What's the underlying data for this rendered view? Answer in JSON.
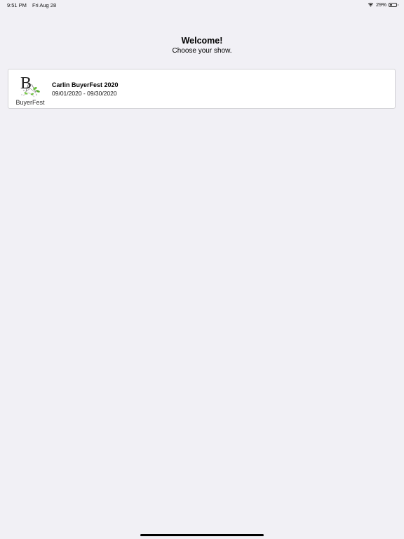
{
  "status_bar": {
    "time": "9:51 PM",
    "date": "Fri Aug 28",
    "battery_percent": "29%",
    "battery_level": 0.29
  },
  "welcome": {
    "title": "Welcome!",
    "subtitle": "Choose your show."
  },
  "shows": [
    {
      "name": "Carlin BuyerFest 2020",
      "dates": "09/01/2020 - 09/30/2020",
      "logo": {
        "letter": "B",
        "wordmark": "BuyerFest",
        "accent_color": "#6cbf3f"
      }
    }
  ]
}
